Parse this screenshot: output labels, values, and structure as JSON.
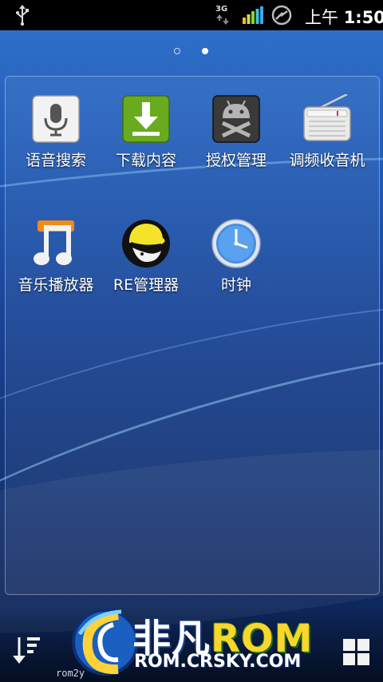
{
  "status_bar": {
    "network": "3G",
    "time_period": "上午",
    "time": "1:50"
  },
  "pager": {
    "pages": 2,
    "current": 2
  },
  "apps": [
    {
      "label": "语音搜索",
      "icon": "microphone-icon"
    },
    {
      "label": "下载内容",
      "icon": "download-icon"
    },
    {
      "label": "授权管理",
      "icon": "superuser-android-icon"
    },
    {
      "label": "调频收音机",
      "icon": "radio-icon"
    },
    {
      "label": "音乐播放器",
      "icon": "music-note-icon"
    },
    {
      "label": "RE管理器",
      "icon": "redhat-fedora-icon"
    },
    {
      "label": "时钟",
      "icon": "clock-icon"
    }
  ],
  "watermark": {
    "brand_cn": "非凡",
    "brand_rom": "ROM",
    "url": "ROM.CRSKY.COM",
    "small": "rom2y"
  },
  "colors": {
    "wallpaper_top": "#2f6fc9",
    "wallpaper_bottom": "#0b1f4b",
    "label": "#ffffff",
    "brand_yellow": "#f8d62c"
  }
}
